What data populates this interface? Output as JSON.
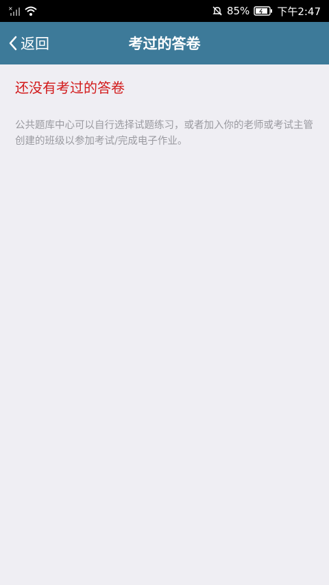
{
  "status_bar": {
    "battery": "85%",
    "time": "下午2:47",
    "icons": [
      "no-sim-signal-icon",
      "wifi-icon",
      "mute-bell-icon",
      "battery-icon"
    ]
  },
  "header": {
    "back_label": "返回",
    "title": "考过的答卷",
    "color": "#3d7a99"
  },
  "empty_state": {
    "title": "还没有考过的答卷",
    "description": "公共题库中心可以自行选择试题练习，或者加入你的老师或考试主管创建的班级以参加考试/完成电子作业。",
    "title_color": "#d2191a"
  }
}
